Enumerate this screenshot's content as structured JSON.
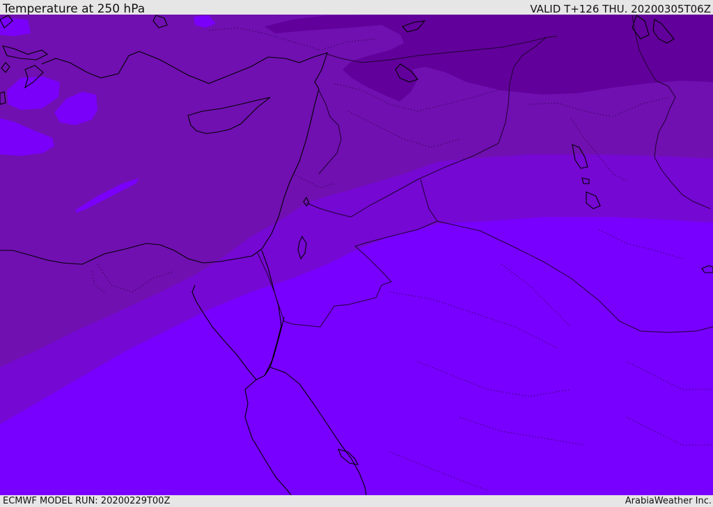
{
  "header": {
    "title": "Temperature at 250 hPa",
    "valid_time": "VALID T+126 THU. 20200305T06Z"
  },
  "footer": {
    "model_run": "ECMWF MODEL RUN: 20200229T00Z",
    "credit": "ArabiaWeather Inc."
  },
  "map": {
    "field": "temperature-250hPa",
    "colors": {
      "coldest": "#62009b",
      "colder": "#7010b0",
      "cold": "#7508d2",
      "mild": "#7800fe",
      "pocket": "#7a00fa",
      "coastline": "#000000",
      "border": "#2a0040"
    }
  }
}
